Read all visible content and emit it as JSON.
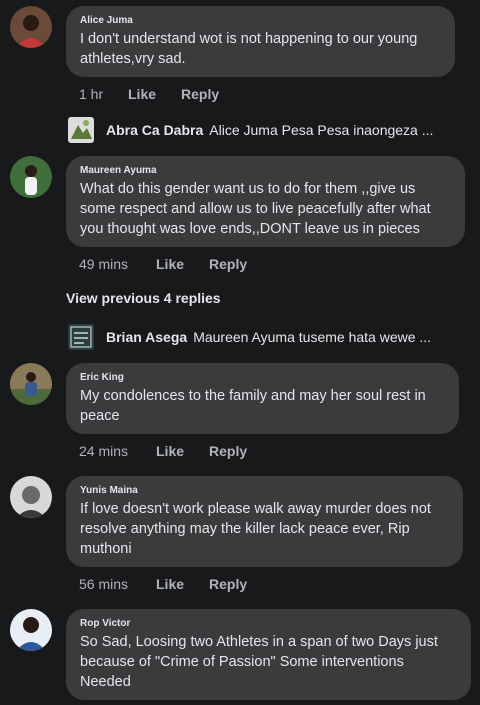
{
  "comments": [
    {
      "author": "Alice Juma",
      "text": "I don't understand wot is not happening  to our young athletes,vry sad.",
      "time": "1 hr",
      "like": "Like",
      "reply": "Reply"
    },
    {
      "author": "Maureen Ayuma",
      "text": "What do this gender want us to do for them ,,give us some respect and allow us to live peacefully after what you thought was love ends,,DONT leave us in pieces",
      "time": "49 mins",
      "like": "Like",
      "reply": "Reply"
    },
    {
      "author": "Eric King",
      "text": "My condolences to the family and may her soul rest in peace",
      "time": "24 mins",
      "like": "Like",
      "reply": "Reply"
    },
    {
      "author": "Yunis Maina",
      "text": "If love doesn't work please walk away murder does not resolve anything may the killer lack peace ever, Rip muthoni",
      "time": "56 mins",
      "like": "Like",
      "reply": "Reply"
    },
    {
      "author": "Rop Victor",
      "text": "So Sad, Loosing two Athletes in a span of two Days just because of  \"Crime of Passion\" Some interventions Needed"
    }
  ],
  "replies": [
    {
      "author": "Abra Ca Dabra",
      "text": "Alice Juma Pesa Pesa inaongeza ..."
    },
    {
      "author": "Brian Asega",
      "text": "Maureen Ayuma tuseme hata wewe ..."
    }
  ],
  "view_previous": "View previous 4 replies"
}
